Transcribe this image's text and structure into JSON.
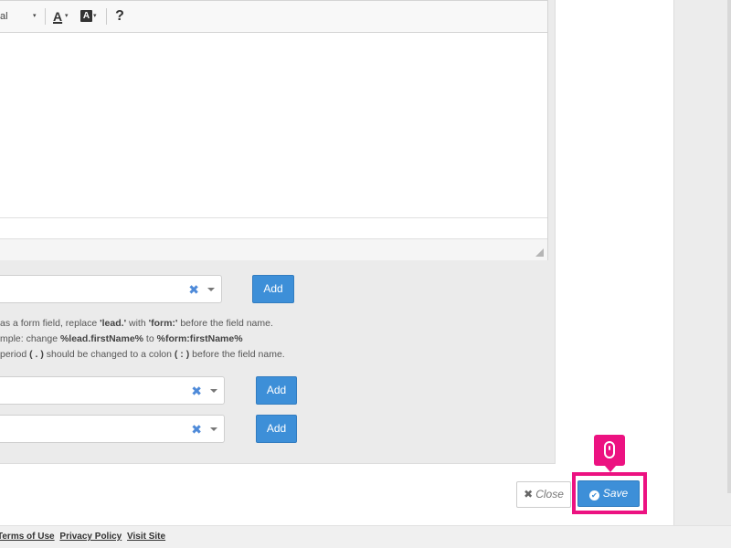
{
  "toolbar": {
    "font_name": "al",
    "text_color_glyph": "A",
    "bg_color_glyph": "A",
    "caret_glyph": "▾",
    "help_glyph": "?"
  },
  "selects": [
    {
      "clear_glyph": "✖",
      "add_label": "Add"
    },
    {
      "clear_glyph": "✖",
      "add_label": "Add"
    },
    {
      "clear_glyph": "✖",
      "add_label": "Add"
    }
  ],
  "help": {
    "line1_pre": "as a form field, replace ",
    "line1_b1": "'lead.'",
    "line1_mid": " with ",
    "line1_b2": "'form:'",
    "line1_post": " before the field name.",
    "line2_pre": "mple: change ",
    "line2_b1": "%lead.firstName%",
    "line2_mid": " to ",
    "line2_b2": "%form:firstName%",
    "line3_pre": " period ",
    "line3_b1": "( . )",
    "line3_mid": " should be changed to a colon ",
    "line3_b2": "( : )",
    "line3_post": " before the field name."
  },
  "buttons": {
    "close_glyph": "✖",
    "close_label": "Close",
    "save_glyph": "✔",
    "save_label": "Save"
  },
  "footer": {
    "links": [
      "Terms of Use",
      "Privacy Policy",
      "Visit Site"
    ]
  },
  "colors": {
    "accent": "#3d8fd8",
    "highlight": "#ec1281"
  }
}
